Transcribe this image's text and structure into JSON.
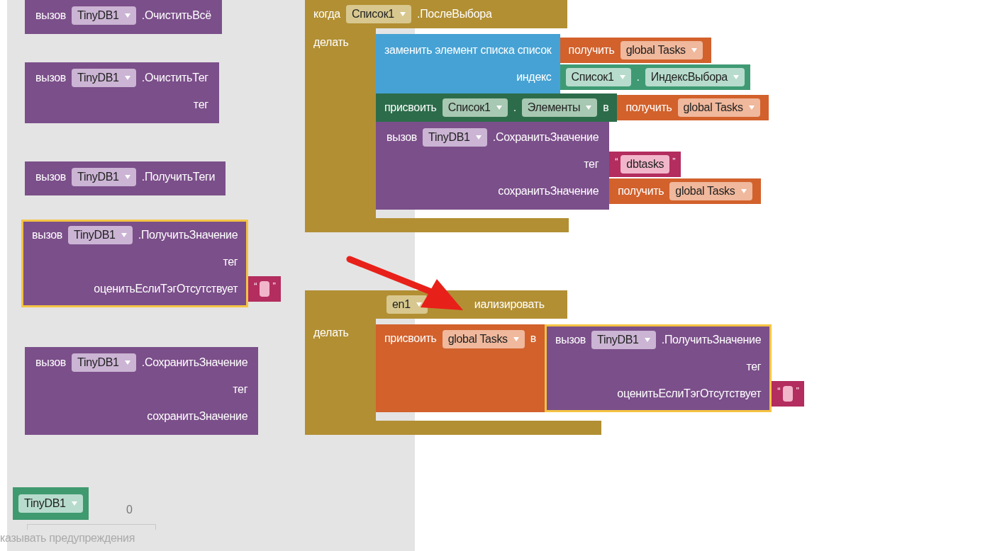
{
  "flyout": {
    "blocks": [
      {
        "kind": "call",
        "keyword": "вызов",
        "component": "TinyDB1",
        "method": ".ОчиститьВсё",
        "selected": false
      },
      {
        "kind": "call",
        "keyword": "вызов",
        "component": "TinyDB1",
        "method": ".ОчиститьТег",
        "selected": false,
        "sockets": [
          {
            "label": "тег"
          }
        ]
      },
      {
        "kind": "call",
        "keyword": "вызов",
        "component": "TinyDB1",
        "method": ".ПолучитьТеги",
        "selected": false
      },
      {
        "kind": "call",
        "keyword": "вызов",
        "component": "TinyDB1",
        "method": ".ПолучитьЗначение",
        "selected": true,
        "sockets": [
          {
            "label": "тег"
          },
          {
            "label": "оценитьЕслиТэгОтсутствует",
            "value": {
              "kind": "text",
              "open": "“",
              "close": "”"
            }
          }
        ]
      },
      {
        "kind": "call",
        "keyword": "вызов",
        "component": "TinyDB1",
        "method": ".СохранитьЗначение",
        "selected": false,
        "sockets": [
          {
            "label": "тег"
          },
          {
            "label": "сохранитьЗначение"
          }
        ]
      },
      {
        "kind": "component",
        "component": "TinyDB1"
      }
    ],
    "warning_count": "0",
    "warnings_label": "казывать предупреждения"
  },
  "workspace": {
    "events": [
      {
        "keyword": "когда",
        "component": "Список1",
        "event": ".ПослеВыбора",
        "do_label": "делать",
        "body": [
          {
            "kind": "replace_item",
            "sockets": [
              {
                "label": "заменить элемент списка список",
                "value": {
                  "kind": "get",
                  "keyword": "получить",
                  "variable": "global Tasks"
                }
              },
              {
                "label": "индекс",
                "value": {
                  "kind": "property_getter",
                  "component": "Список1",
                  "dot": ".",
                  "property": "ИндексВыбора"
                }
              }
            ]
          },
          {
            "kind": "set_property",
            "keyword": "присвоить",
            "component": "Список1",
            "dot": ".",
            "property": "Элементы",
            "to": "в",
            "value": {
              "kind": "get",
              "keyword": "получить",
              "variable": "global Tasks"
            }
          },
          {
            "kind": "call",
            "keyword": "вызов",
            "component": "TinyDB1",
            "method": ".СохранитьЗначение",
            "selected": false,
            "sockets": [
              {
                "label": "тег",
                "value": {
                  "kind": "text",
                  "open": "“",
                  "text": "dbtasks",
                  "close": "”"
                }
              },
              {
                "label": "сохранитьЗначение",
                "value": {
                  "kind": "get",
                  "keyword": "получить",
                  "variable": "global Tasks"
                }
              }
            ]
          }
        ]
      },
      {
        "component": "en1",
        "event": "иализировать",
        "do_label": "делать",
        "body": [
          {
            "kind": "set_global",
            "keyword": "присвоить",
            "variable": "global Tasks",
            "to": "в",
            "value": {
              "kind": "call",
              "keyword": "вызов",
              "component": "TinyDB1",
              "method": ".ПолучитьЗначение",
              "selected": true,
              "sockets": [
                {
                  "label": "тег"
                },
                {
                  "label": "оценитьЕслиТэгОтсутствует",
                  "value": {
                    "kind": "text",
                    "open": "“",
                    "close": "”"
                  }
                }
              ]
            }
          }
        ]
      }
    ]
  }
}
